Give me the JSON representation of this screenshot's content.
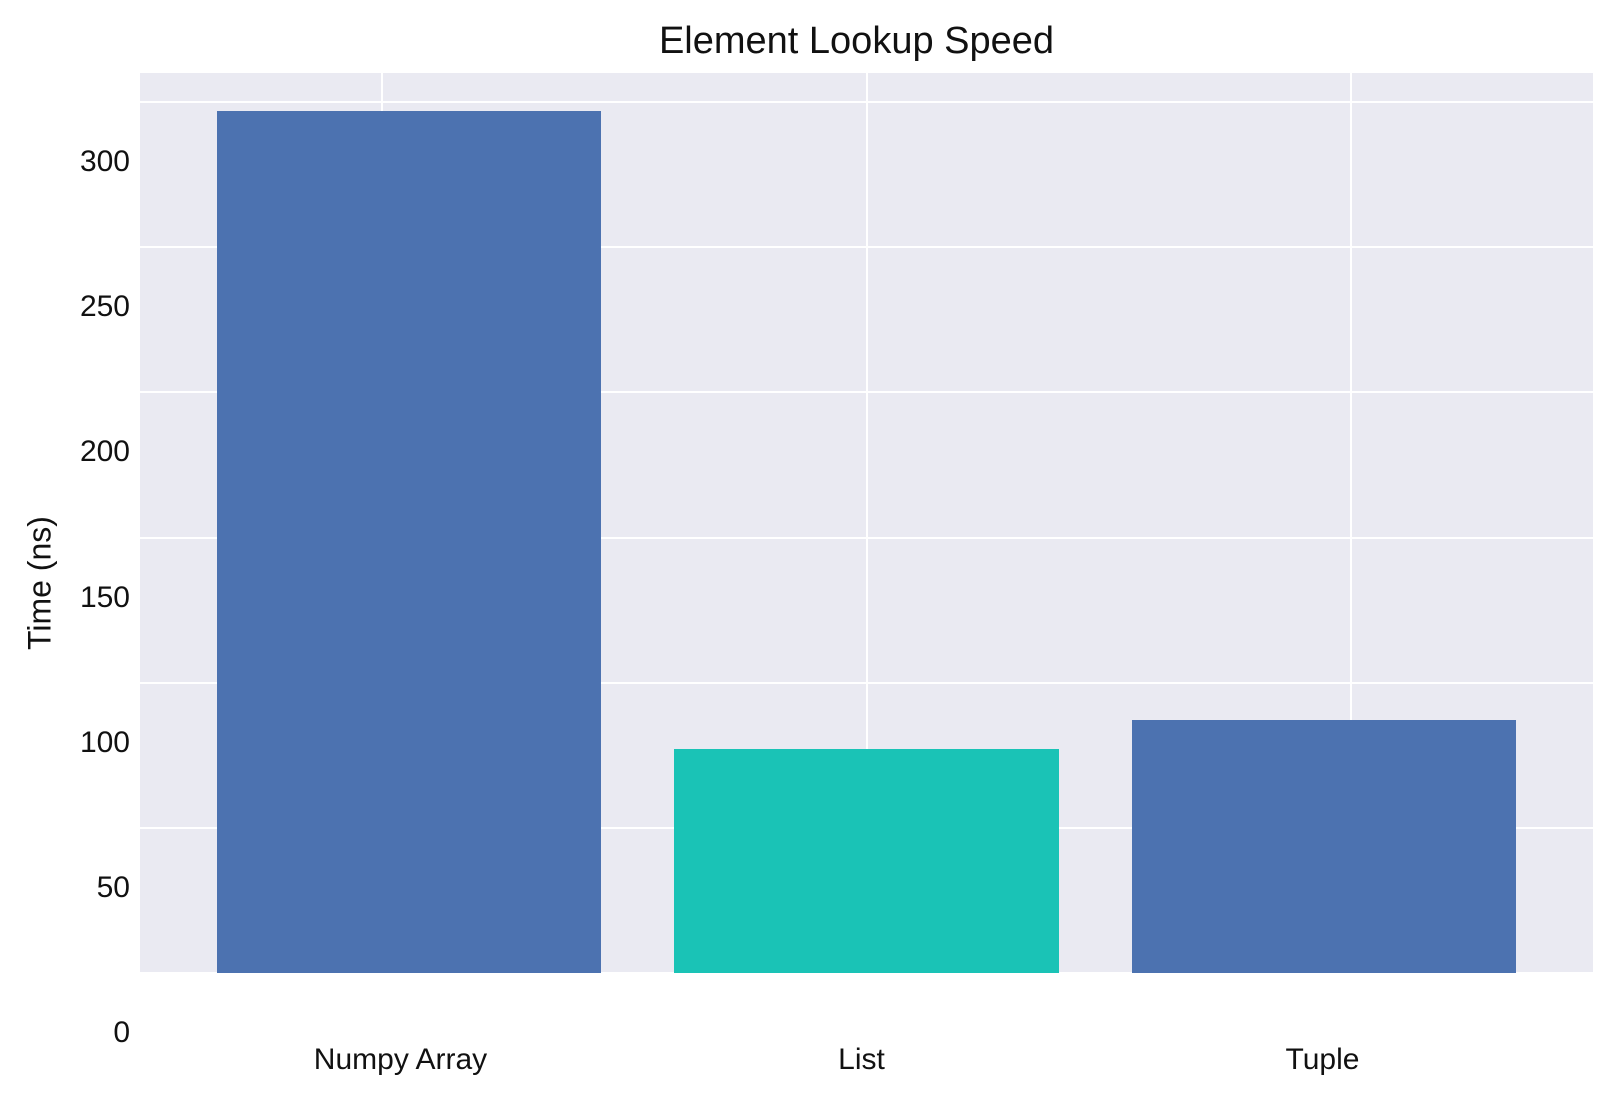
{
  "chart_data": {
    "type": "bar",
    "title": "Element Lookup Speed",
    "xlabel": "",
    "ylabel": "Time (ns)",
    "categories": [
      "Numpy Array",
      "List",
      "Tuple"
    ],
    "values": [
      297,
      77,
      87
    ],
    "colors": [
      "#4c72b0",
      "#1ac3b6",
      "#4c72b0"
    ],
    "ylim": [
      0,
      310
    ],
    "yticks": [
      0,
      50,
      100,
      150,
      200,
      250,
      300
    ],
    "grid": true
  }
}
